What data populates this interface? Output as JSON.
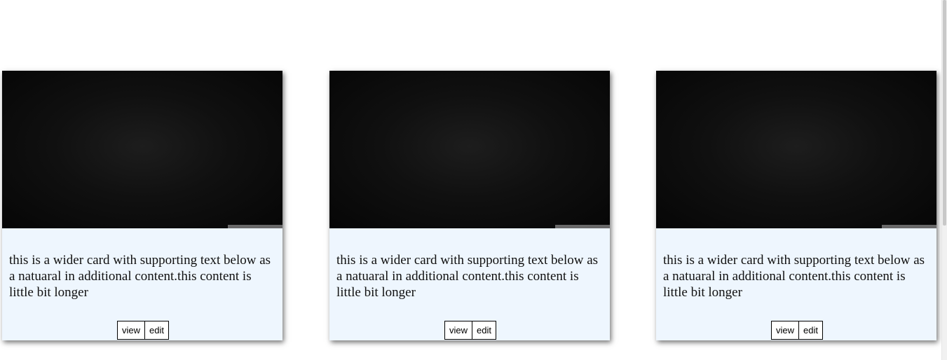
{
  "cards": [
    {
      "text": "this is a wider card with supporting text below as a natuaral in additional content.this content is little bit longer",
      "buttons": {
        "view": "view",
        "edit": "edit"
      }
    },
    {
      "text": "this is a wider card with supporting text below as a natuaral in additional content.this content is little bit longer",
      "buttons": {
        "view": "view",
        "edit": "edit"
      }
    },
    {
      "text": "this is a wider card with supporting text below as a natuaral in additional content.this content is little bit longer",
      "buttons": {
        "view": "view",
        "edit": "edit"
      }
    }
  ],
  "colors": {
    "page_background": "#ffffff",
    "card_body_background": "#eef6fe",
    "image_background": "#0a0a0a",
    "button_border": "#000000"
  }
}
